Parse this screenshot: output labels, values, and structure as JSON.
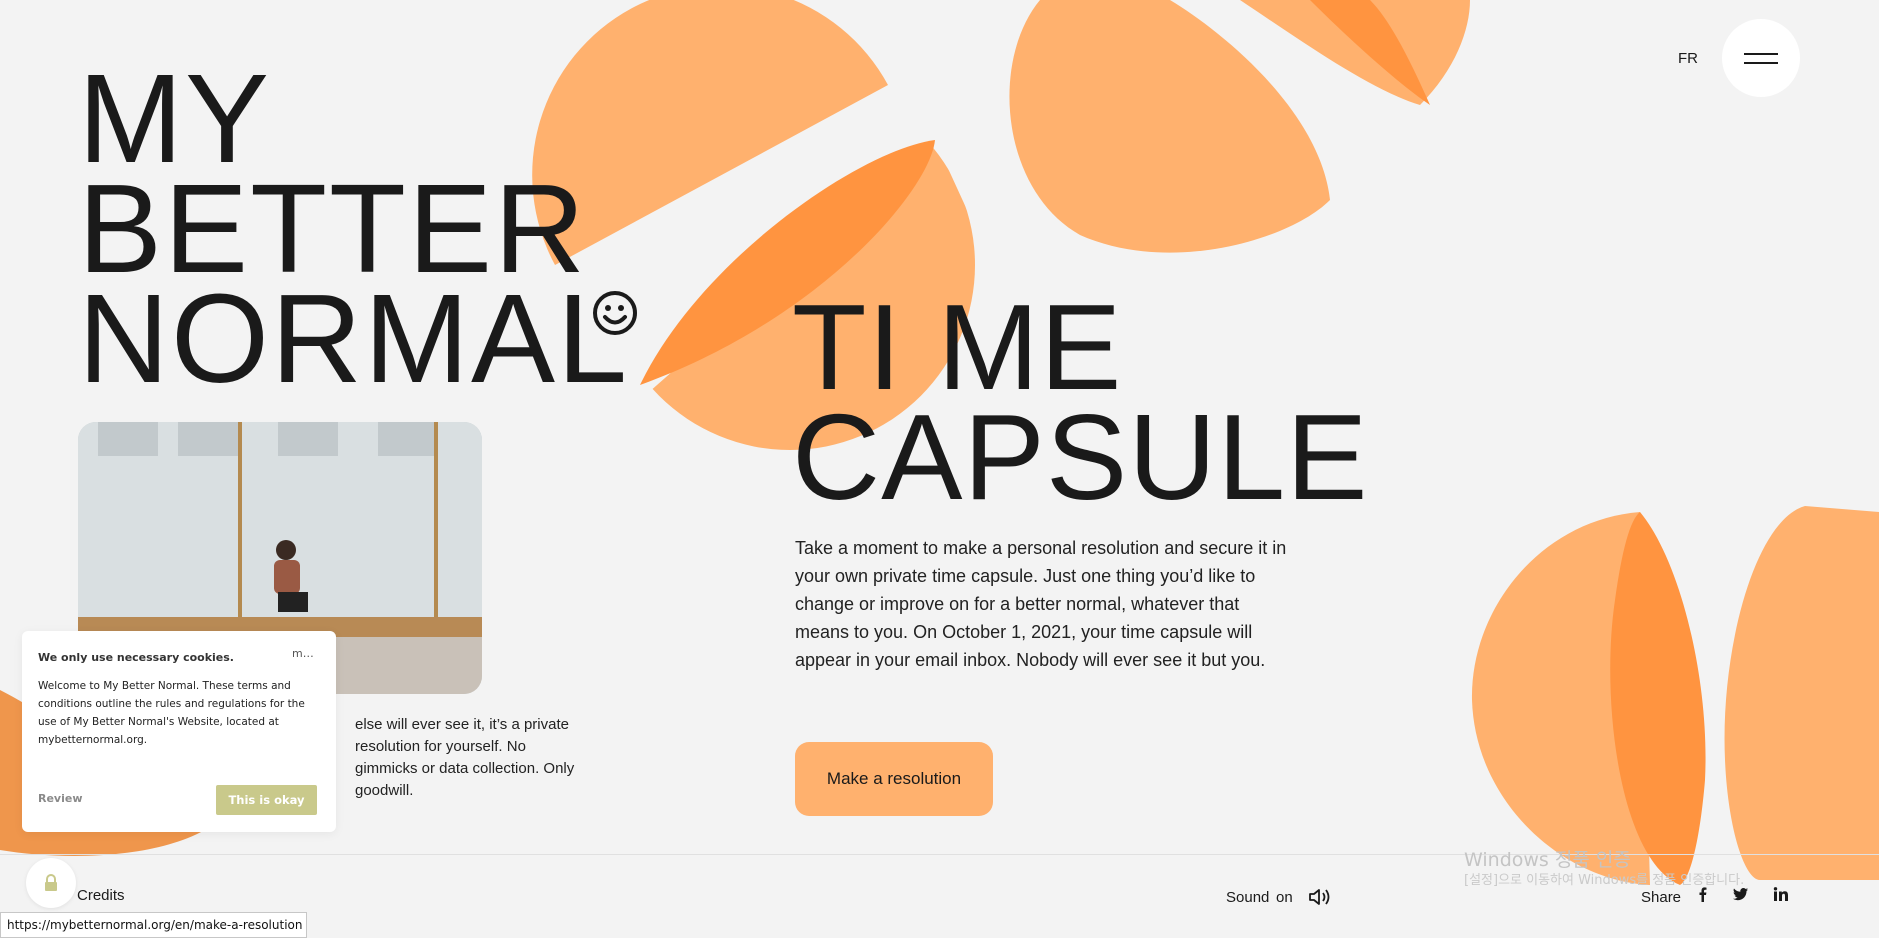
{
  "hero": {
    "line1": "MY",
    "line2": "BETTER",
    "line3": "NORMAL"
  },
  "nav": {
    "lang": "FR",
    "menu_icon": "hamburger-icon"
  },
  "blurb": "else will ever see it, it’s a private resolution for yourself. No gimmicks or data collection. Only goodwill.",
  "section": {
    "title_line1": "TI ME",
    "title_line2": "CAPSULE",
    "description": "Take a moment to make a personal resolution and secure it in your own private time capsule. Just one thing you’d like to change or improve on for a better normal, whatever that means to you. On October 1, 2021, your time capsule will appear in your email inbox. Nobody will ever see it but you.",
    "cta": "Make a resolution"
  },
  "cookie": {
    "title": "We only use necessary cookies.",
    "minimize": "m…",
    "body": "Welcome to My Better Normal. These terms and conditions outline the rules and regulations for the use of My Better Normal's Website, located at mybetternormal.org.",
    "review": "Review",
    "accept": "This is okay"
  },
  "footer": {
    "credits": "Credits",
    "sound_label": "Sound",
    "sound_state": "on",
    "share": "Share",
    "icons": [
      "lock-icon",
      "speaker-icon",
      "facebook-icon",
      "twitter-icon",
      "linkedin-icon"
    ]
  },
  "status_url": "https://mybetternormal.org/en/make-a-resolution",
  "os_watermark": {
    "line1": "Windows 정품 인증",
    "line2": "[설정]으로 이동하여 Windows를 정품 인증합니다."
  },
  "colors": {
    "background": "#f3f3f3",
    "orange_light": "#ffb16e",
    "orange_dark": "#ff9440",
    "cookie_accept": "#c9c98b"
  }
}
